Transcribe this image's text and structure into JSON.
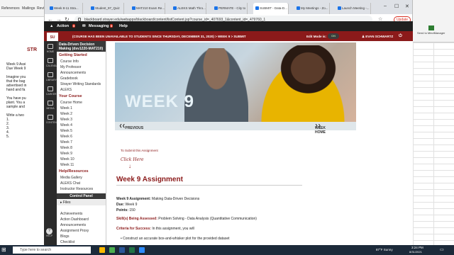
{
  "word": {
    "ribbon": [
      "References",
      "Mailings",
      "Review"
    ],
    "doc_lines": [
      "Week 9 Assi",
      "Due Week 9",
      "",
      "Imagine you",
      "that the bag",
      "advertised in",
      "hand and fa",
      "",
      "You have pu",
      "plant. You a",
      "sample and",
      "",
      "Write a two",
      "1.",
      "2.",
      "3.",
      "4.",
      "5."
    ],
    "logo_text": "STR"
  },
  "browser": {
    "tabs": [
      "Week 8-11 Stra...",
      "Student_97_Quiz",
      "MAT210 Exam Re...",
      "ALEKS Math Thro...",
      "PERMATE - City to",
      "SUBMIT - Data-D...",
      "My Meetings - Zo...",
      "Launch Meeting -..."
    ],
    "url": "blackboard.strayer.edu/webapps/blackboard/content/listContent.jsp?course_id=_407693_1&content_id=_479760_1",
    "update_label": "Update",
    "bookmarks": "Apps"
  },
  "topnav": {
    "action": "Action",
    "action_count": "9",
    "messaging": "Messaging",
    "messaging_count": "9",
    "help": "Help"
  },
  "redbar": {
    "crumb": "(COURSE HAS BEEN UNAVAILABLE TO STUDENTS SINCE THURSDAY, DECEMBER 31, 2020)  >  WEEK 9  >  SUBMIT",
    "edit_mode": "Edit Mode is:",
    "toggle": "ON",
    "user": "EVAN SCHWARTZ"
  },
  "rail": [
    "HOME",
    "CALENDAR",
    "LIBRARY",
    "CAREER",
    "MEDIA",
    "CONTENT"
  ],
  "rail_help": "HELP",
  "menu": {
    "course_title": "Data-Driven Decision Making (dsv1220-MAT210)",
    "getting_started": "Getting Started",
    "gs_items": [
      "Course Info",
      "My Professor",
      "Announcements",
      "Gradebook",
      "Strayer Writing Standards",
      "ALEKS"
    ],
    "your_course": "Your Course",
    "course_items": [
      "Course Home",
      "Week 1",
      "Week 2",
      "Week 3",
      "Week 4",
      "Week 5",
      "Week 6",
      "Week 7",
      "Week 8",
      "Week 9",
      "Week 10",
      "Week 11"
    ],
    "help_resources": "Help/Resources",
    "help_items": [
      "Media Gallery",
      "ALEKS Chat",
      "Instructor Resources"
    ],
    "control_panel": "Control Panel",
    "files": "Files",
    "cp_items": [
      "Achievements",
      "Action Dashboard",
      "Announcements",
      "Assignment Proxy",
      "Blogs",
      "Checklist",
      "Decision Board"
    ]
  },
  "content": {
    "hero_text": "WEEK 9",
    "previous": "PREVIOUS",
    "week_home": "WEEK HOME",
    "submit_note": "To Submit this Assignment",
    "click_here": "Click Here",
    "title": "Week 9 Assignment",
    "l1_label": "Week 9 Assignment:",
    "l1_value": "Making Data-Driven Decisions",
    "l2_label": "Due:",
    "l2_value": "Week 9",
    "l3_label": "Points:",
    "l3_value": "150",
    "l4_label": "Skill(s) Being Assessed:",
    "l4_value": "Problem Solving - Data Analysis (Quantitative Communication)",
    "l5_label": "Criteria for Success:",
    "l5_value": "In this assignment, you will",
    "l6_value": "Construct an accurate box-and-whisker plot for the provided dataset"
  },
  "excel": {
    "send_to": "Send to MindManager"
  },
  "taskbar": {
    "search_placeholder": "Type here to search",
    "weather": "87°F  Sunny",
    "time": "3:24 PM",
    "date": "8/31/2021"
  },
  "colors": {
    "brand_red": "#8b1a1a",
    "dark": "#1f1f1f"
  }
}
